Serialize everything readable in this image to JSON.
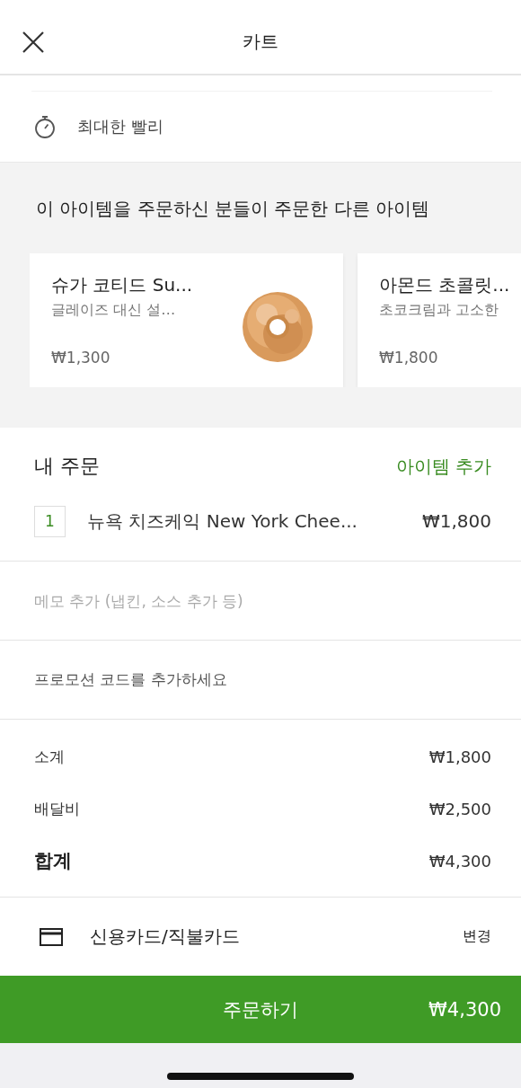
{
  "header": {
    "title": "카트"
  },
  "delivery": {
    "label": "최대한 빨리"
  },
  "recommendations": {
    "heading": "이 아이템을 주문하신 분들이 주문한 다른 아이템",
    "items": [
      {
        "name": "슈가 코티드 Su...",
        "description": "글레이즈 대신 설…",
        "price": "₩1,300"
      },
      {
        "name": "아몬드 초콜릿...",
        "description": "초코크림과 고소한",
        "price": "₩1,800"
      }
    ]
  },
  "order": {
    "heading": "내 주문",
    "add_link": "아이템 추가",
    "items": [
      {
        "quantity": "1",
        "name": "뉴욕 치즈케익 New York Chee...",
        "price": "₩1,800"
      }
    ]
  },
  "memo": {
    "placeholder": "메모 추가 (냅킨, 소스 추가 등)"
  },
  "promo": {
    "label": "프로모션 코드를 추가하세요"
  },
  "totals": [
    {
      "kind": "line",
      "label": "소계",
      "value": "₩1,800"
    },
    {
      "kind": "line",
      "label": "배달비",
      "value": "₩2,500"
    },
    {
      "kind": "total",
      "label": "합계",
      "value": "₩4,300"
    }
  ],
  "payment": {
    "method": "신용카드/직불카드",
    "change": "변경"
  },
  "checkout": {
    "label": "주문하기",
    "amount": "₩4,300"
  }
}
